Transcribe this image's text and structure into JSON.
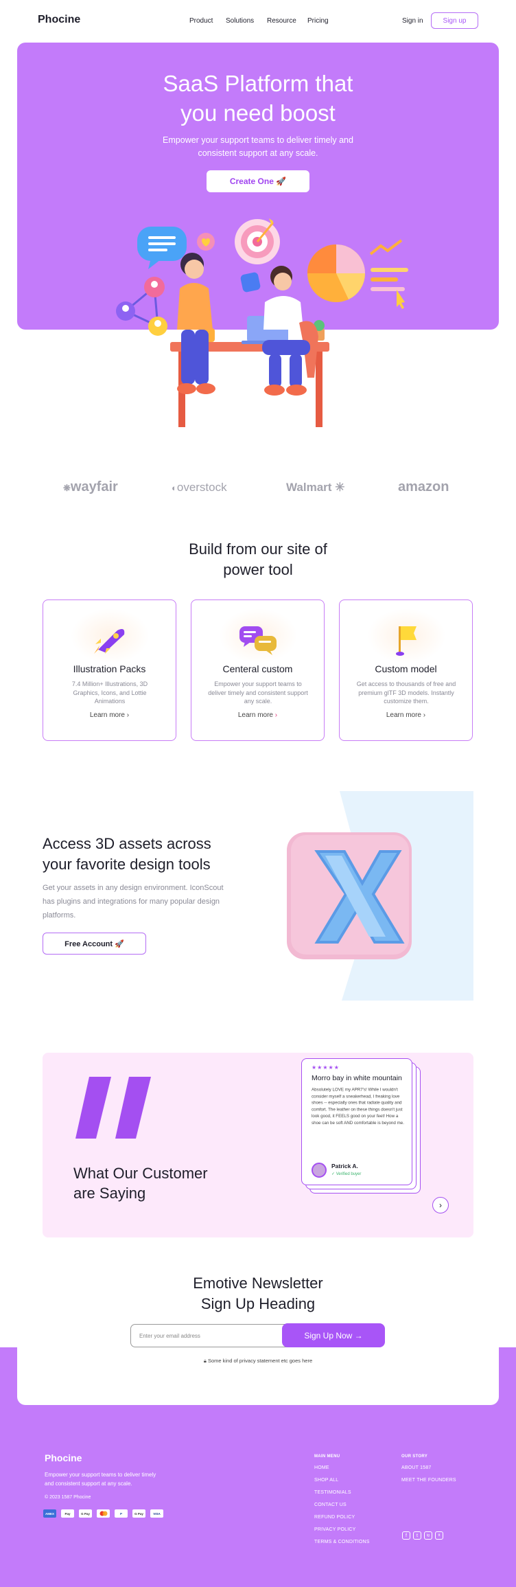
{
  "nav": {
    "logo": "Phocine",
    "items": [
      "Product",
      "Solutions",
      "Resource",
      "Pricing"
    ],
    "signin": "Sign in",
    "signup": "Sign up"
  },
  "hero": {
    "title_line1": "SaaS Platform that",
    "title_line2": "you need boost",
    "subtitle_line1": "Empower your support teams to deliver timely and",
    "subtitle_line2": "consistent support at any scale.",
    "cta": "Create One 🚀"
  },
  "brands": [
    "wayfair",
    "overstock",
    "Walmart",
    "amazon"
  ],
  "build": {
    "title_line1": "Build from our site of",
    "title_line2": "power tool",
    "cards": [
      {
        "title": "Illustration Packs",
        "desc": "7.4 Million+ Illustrations, 3D Graphics, Icons, and Lottie Animations",
        "link": "Learn more",
        "icon": "rocket-icon"
      },
      {
        "title": "Centeral custom",
        "desc": "Empower your support teams to deliver timely and consistent support any scale.",
        "link": "Learn more",
        "icon": "chat-bubbles-icon"
      },
      {
        "title": "Custom model",
        "desc": "Get access to thousands of free and premium glTF 3D models. Instantly customize them.",
        "link": "Learn more",
        "icon": "flag-icon"
      }
    ]
  },
  "access": {
    "title_line1": "Access 3D assets across",
    "title_line2": "your favorite design tools",
    "desc": "Get your assets in any design environment. IconScout has plugins and integrations for many popular design platforms.",
    "button": "Free Account 🚀"
  },
  "testimonial": {
    "heading_line1": "What Our Customer",
    "heading_line2": "are Saying",
    "stars": "★★★★★",
    "review_title": "Morro bay in white mountain",
    "review_text": "Absolutely LOVE my APR7's! While I wouldn't consider myself a sneakerhead, I freaking love shoes -- especially ones that radiate quality and comfort. The leather on these things doesn't just look good, it FEELS good on your feet! How a shoe can be soft AND comfortable is beyond me.",
    "reviewer": "Patrick A.",
    "verified": "✓ Verified buyer"
  },
  "newsletter": {
    "title_line1": "Emotive Newsletter",
    "title_line2": "Sign Up Heading",
    "placeholder": "Enter your email address",
    "button": "Sign Up Now →",
    "privacy": "Some kind of privacy statement etc goes here"
  },
  "footer": {
    "logo": "Phocine",
    "desc": "Empower your support teams to deliver timely and consistent support at any scale.",
    "copyright": "© 2023 1587 Phocine",
    "payments": [
      "AMEX",
      "Pay",
      "G Pay",
      "MC",
      "P",
      "G Pay",
      "VISA"
    ],
    "main_menu_title": "MAIN MENU",
    "main_menu": [
      "HOME",
      "SHOP ALL",
      "TESTIMONIALS",
      "CONTACT US",
      "REFUND POLICY",
      "PRIVACY POLICY",
      "TERMS & CONDITIONS"
    ],
    "story_title": "OUR STORY",
    "story": [
      "ABOUT 1587",
      "MEET THE FOUNDERS"
    ],
    "social": [
      "f",
      "t",
      "ig",
      "tt"
    ]
  }
}
